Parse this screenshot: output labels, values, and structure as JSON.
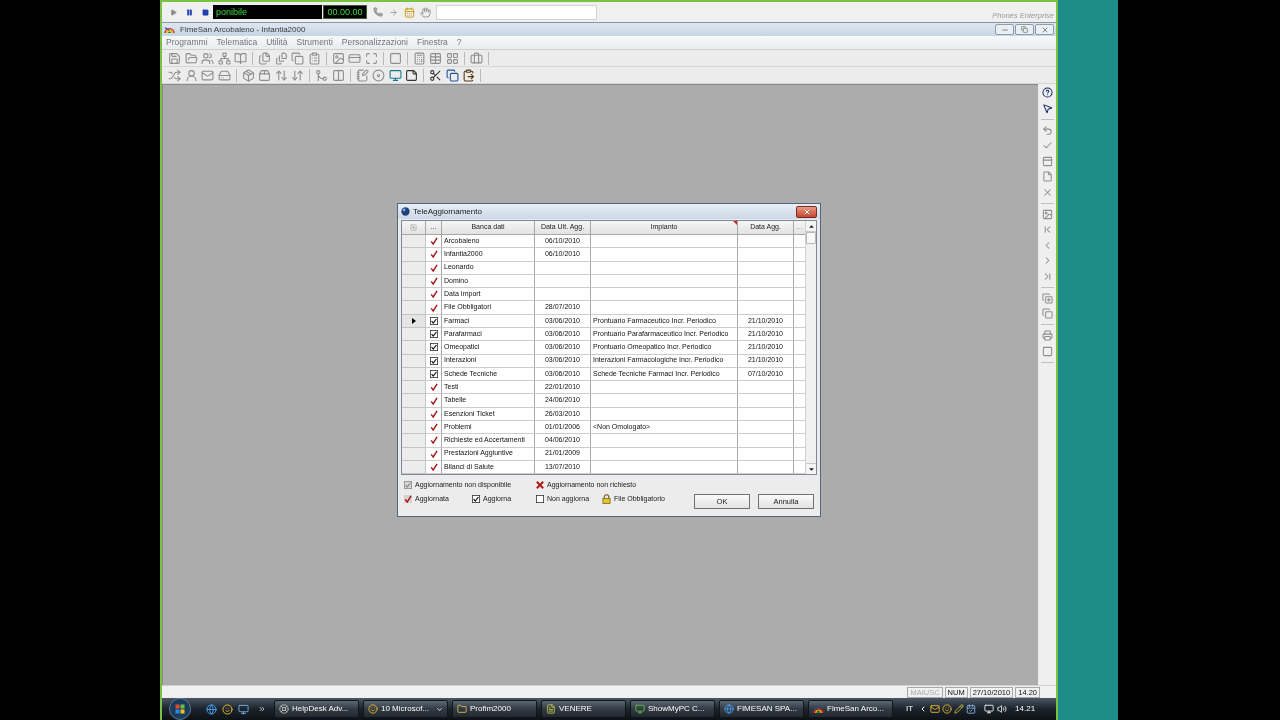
{
  "recorder_bar": {
    "display": "ponibile",
    "timer": "00.00.00",
    "brand": "Phones Enterprise"
  },
  "window": {
    "title": "FimeSan Arcobaleno - Infantia2000"
  },
  "menu": [
    "Programmi",
    "Telematica",
    "Utilità",
    "Strumenti",
    "Personalizzazioni",
    "Finestra",
    "?"
  ],
  "dialog": {
    "title": "TeleAggiornamento",
    "columns": [
      "...",
      "Banca dati",
      "Data Ult. Agg.",
      "Impianto",
      "Data Agg.",
      "..."
    ],
    "rows": [
      {
        "kind": "updated",
        "selected": false,
        "name": "Arcobaleno",
        "last_update": "06/10/2010"
      },
      {
        "kind": "updated",
        "selected": false,
        "name": "Infantia2000",
        "last_update": "06/10/2010"
      },
      {
        "kind": "updated",
        "selected": false,
        "name": "Leonardo"
      },
      {
        "kind": "updated",
        "selected": false,
        "name": "Domino"
      },
      {
        "kind": "updated",
        "selected": false,
        "name": "Data Import"
      },
      {
        "kind": "updated",
        "selected": false,
        "name": "File Obbligatori",
        "last_update": "28/07/2010"
      },
      {
        "kind": "update",
        "selected": true,
        "name": "Farmaci",
        "last_update": "03/06/2010",
        "plant": "Prontuario Farmaceutico Incr. Periodico",
        "update_date": "21/10/2010"
      },
      {
        "kind": "update",
        "selected": false,
        "name": "Parafarmaci",
        "last_update": "03/06/2010",
        "plant": "Prontuario Parafarmaceutico Incr. Periodico",
        "update_date": "21/10/2010"
      },
      {
        "kind": "update",
        "selected": false,
        "name": "Omeopatici",
        "last_update": "03/06/2010",
        "plant": "Prontuario Omeopatico Incr. Periodico",
        "update_date": "21/10/2010"
      },
      {
        "kind": "update",
        "selected": false,
        "name": "Interazioni",
        "last_update": "03/06/2010",
        "plant": "Interazioni Farmacologiche Incr. Periodico",
        "update_date": "21/10/2010"
      },
      {
        "kind": "update",
        "selected": false,
        "name": "Schede Tecniche",
        "last_update": "03/06/2010",
        "plant": "Schede Tecniche Farmaci Incr. Periodico",
        "update_date": "07/10/2010"
      },
      {
        "kind": "updated",
        "selected": false,
        "name": "Testi",
        "last_update": "22/01/2010"
      },
      {
        "kind": "updated",
        "selected": false,
        "name": "Tabelle",
        "last_update": "24/06/2010"
      },
      {
        "kind": "updated",
        "selected": false,
        "name": "Esenzioni Ticket",
        "last_update": "26/03/2010"
      },
      {
        "kind": "updated",
        "selected": false,
        "name": "Problemi",
        "last_update": "01/01/2006",
        "plant": "<Non Omologato>"
      },
      {
        "kind": "updated",
        "selected": false,
        "name": "Richieste ed Accertamenti",
        "last_update": "04/06/2010"
      },
      {
        "kind": "updated",
        "selected": false,
        "name": "Prestazioni Aggiuntive",
        "last_update": "21/01/2009"
      },
      {
        "kind": "updated",
        "selected": false,
        "name": "Bilanci di Salute",
        "last_update": "13/07/2010"
      }
    ],
    "legend": [
      [
        {
          "kind": "unavailable",
          "label": "Aggiornamento non disponibile"
        },
        {
          "kind": "not_requested",
          "label": "Aggiornamento non richiesto"
        }
      ],
      [
        {
          "kind": "updated",
          "label": "Aggiornata"
        },
        {
          "kind": "update",
          "label": "Aggiorna"
        },
        {
          "kind": "no_update",
          "label": "Non aggiorna"
        },
        {
          "kind": "mandatory",
          "label": "File Obbligatorio"
        }
      ]
    ],
    "buttons": [
      "OK",
      "Annulla"
    ]
  },
  "status_bar": {
    "indicators": [
      {
        "label": "MAIUSC",
        "on": false
      },
      {
        "label": "NUM",
        "on": true
      }
    ],
    "date": "27/10/2010",
    "time": "14.20"
  },
  "taskbar": {
    "tasks": [
      {
        "label": "HelpDesk Adv...",
        "grouped": false
      },
      {
        "label": "10 Microsof...",
        "grouped": true
      },
      {
        "label": "Profim2000",
        "grouped": false
      },
      {
        "label": "VENERE",
        "grouped": false
      },
      {
        "label": "ShowMyPC C...",
        "grouped": false
      },
      {
        "label": "FIMESAN SPA...",
        "grouped": false
      },
      {
        "label": "FimeSan Arco...",
        "grouped": false
      }
    ],
    "language": "IT",
    "clock": "14.21"
  }
}
